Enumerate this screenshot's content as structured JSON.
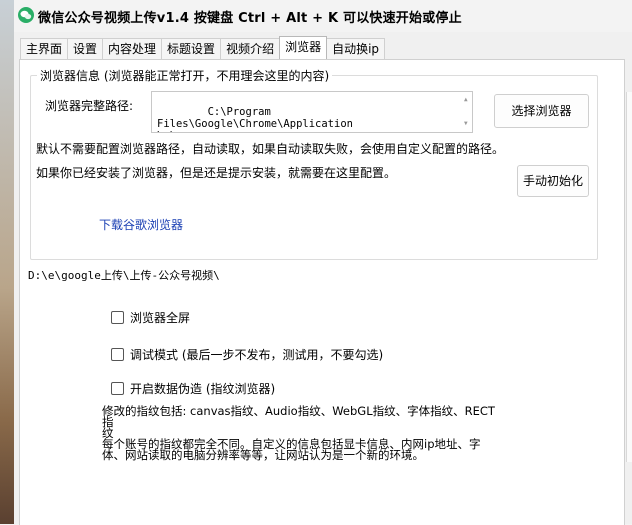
{
  "window": {
    "title": "微信公众号视频上传v1.4    按键盘 Ctrl + Alt + K 可以快速开始或停止",
    "icon": "wechat-icon",
    "accent_green": "#2aae67"
  },
  "tabs": [
    {
      "label": "主界面"
    },
    {
      "label": "设置"
    },
    {
      "label": "内容处理"
    },
    {
      "label": "标题设置"
    },
    {
      "label": "视频介绍"
    },
    {
      "label": "浏览器"
    },
    {
      "label": "自动换ip"
    }
  ],
  "browser_group": {
    "legend": "浏览器信息 (浏览器能正常打开，不用理会这里的内容)",
    "path_label": "浏览器完整路径:",
    "path_value": "C:\\Program Files\\Google\\Chrome\\Application\n\\chrome.exe",
    "select_button": "选择浏览器",
    "default_note": "默认不需要配置浏览器路径，自动读取，如果自动读取失败，会使用自定义配置的路径。",
    "installed_note": "如果你已经安装了浏览器，但是还是提示安装，就需要在这里配置。",
    "init_button": "手动初始化",
    "download_link": "下载谷歌浏览器"
  },
  "work_path": "D:\\e\\google上传\\上传-公众号视频\\",
  "options": [
    {
      "label": "浏览器全屏",
      "checked": false
    },
    {
      "label": "调试模式 (最后一步不发布，测试用，不要勾选)",
      "checked": false
    },
    {
      "label": "开启数据伪造 (指纹浏览器)",
      "checked": false
    }
  ],
  "fingerprint_note": {
    "line1": "修改的指纹包括: canvas指纹、Audio指纹、WebGL指纹、字体指纹、RECT指",
    "line2": "纹",
    "line3": "每个账号的指纹都完全不同。自定义的信息包括显卡信息、内网ip地址、字",
    "line4": "体、网站读取的电脑分辨率等等，让网站认为是一个新的环境。"
  }
}
